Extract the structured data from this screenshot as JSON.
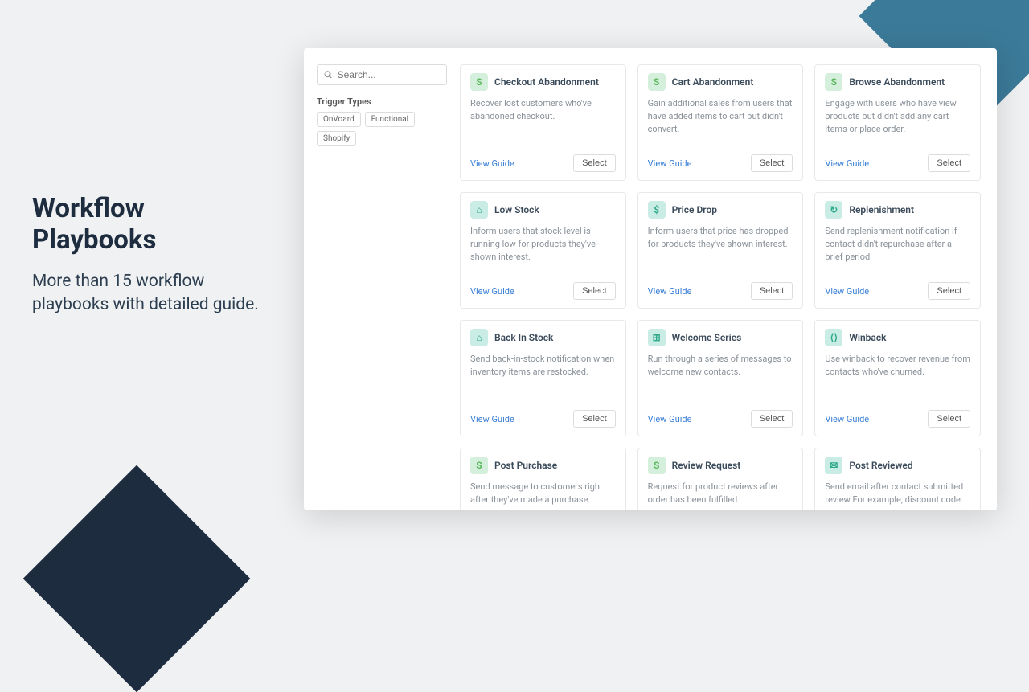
{
  "hero": {
    "title": "Workflow Playbooks",
    "subtitle": "More than 15 workflow playbooks with detailed guide."
  },
  "search": {
    "placeholder": "Search..."
  },
  "filter": {
    "heading": "Trigger Types",
    "tags": [
      "OnVoard",
      "Functional",
      "Shopify"
    ]
  },
  "actions": {
    "view_guide": "View Guide",
    "select": "Select"
  },
  "cards": [
    {
      "title": "Checkout Abandonment",
      "desc": "Recover lost customers who've abandoned checkout.",
      "icon": "shopify",
      "glyph": "S"
    },
    {
      "title": "Cart Abandonment",
      "desc": "Gain additional sales from users that have added items to cart but didn't convert.",
      "icon": "shopify",
      "glyph": "S"
    },
    {
      "title": "Browse Abandonment",
      "desc": "Engage with users who have view products but didn't add any cart items or place order.",
      "icon": "shopify",
      "glyph": "S"
    },
    {
      "title": "Low Stock",
      "desc": "Inform users that stock level is running low for products they've shown interest.",
      "icon": "functional",
      "glyph": "⌂"
    },
    {
      "title": "Price Drop",
      "desc": "Inform users that price has dropped for products they've shown interest.",
      "icon": "functional",
      "glyph": "$"
    },
    {
      "title": "Replenishment",
      "desc": "Send replenishment notification if contact didn't repurchase after a brief period.",
      "icon": "functional",
      "glyph": "↻"
    },
    {
      "title": "Back In Stock",
      "desc": "Send back-in-stock notification when inventory items are restocked.",
      "icon": "functional",
      "glyph": "⌂"
    },
    {
      "title": "Welcome Series",
      "desc": "Run through a series of messages to welcome new contacts.",
      "icon": "onvoard",
      "glyph": "⊞"
    },
    {
      "title": "Winback",
      "desc": "Use winback to recover revenue from contacts who've churned.",
      "icon": "onvoard",
      "glyph": "⟨⟩"
    },
    {
      "title": "Post Purchase",
      "desc": "Send message to customers right after they've made a purchase.",
      "icon": "shopify",
      "glyph": "S",
      "partial": true
    },
    {
      "title": "Review Request",
      "desc": "Request for product reviews after order has been fulfilled.",
      "icon": "shopify",
      "glyph": "S",
      "partial": true
    },
    {
      "title": "Post Reviewed",
      "desc": "Send email after contact submitted review For example, discount code.",
      "icon": "onvoard",
      "glyph": "✉",
      "partial": true
    }
  ]
}
